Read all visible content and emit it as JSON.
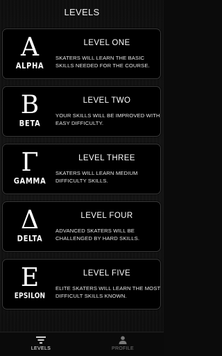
{
  "header": {
    "title": "LEVELS"
  },
  "levels": [
    {
      "letter": "A",
      "word": "ALPHA",
      "title": "LEVEL ONE",
      "description": "SKATERS WILL LEARN THE BASIC SKILLS NEEDED FOR THE COURSE."
    },
    {
      "letter": "B",
      "word": "BETA",
      "title": "LEVEL TWO",
      "description": "YOUR SKILLS WILL BE IMPROVED WITH EASY DIFFICULTY."
    },
    {
      "letter": "Γ",
      "word": "GAMMA",
      "title": "LEVEL THREE",
      "description": "SKATERS WILL LEARN MEDIUM DIFFICULTY SKILLS."
    },
    {
      "letter": "Δ",
      "word": "DELTA",
      "title": "LEVEL FOUR",
      "description": "ADVANCED SKATERS WILL BE CHALLENGED BY HARD SKILLS."
    },
    {
      "letter": "E",
      "word": "EPSILON",
      "title": "LEVEL FIVE",
      "description": "ELITE SKATERS WILL LEARN THE MOST DIFFICULT SKILLS KNOWN."
    }
  ],
  "tabbar": {
    "levels_label": "LEVELS",
    "profile_label": "PROFILE",
    "levels_icon": "filter-list-icon",
    "profile_icon": "person-icon",
    "active_tab": "LEVELS"
  }
}
